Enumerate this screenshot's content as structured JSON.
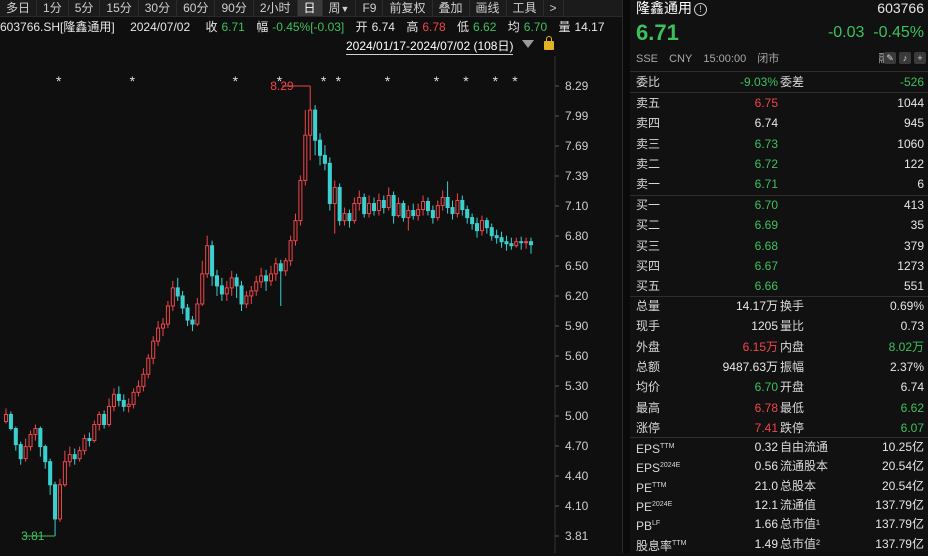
{
  "toolbar": {
    "items": [
      "多日",
      "1分",
      "5分",
      "15分",
      "30分",
      "60分",
      "90分",
      "2小时",
      "日",
      "周",
      "F9",
      "前复权",
      "叠加",
      "画线",
      "工具",
      ">"
    ],
    "active_index": 8
  },
  "infobar": {
    "symbol": "603766.SH[隆鑫通用]",
    "date": "2024/07/02",
    "close_label": "收",
    "close": "6.71",
    "change_label": "幅",
    "change": "-0.45%[-0.03]",
    "open_label": "开",
    "open": "6.74",
    "high_label": "高",
    "high": "6.78",
    "low_label": "低",
    "low": "6.62",
    "avg_label": "均",
    "avg": "6.70",
    "vol_label": "量",
    "vol": "14.17"
  },
  "range_label": "2024/01/17-2024/07/02 (108日)",
  "chart_data": {
    "type": "candlestick",
    "y_ticks": [
      "8.29",
      "7.99",
      "7.69",
      "7.39",
      "7.10",
      "6.80",
      "6.50",
      "6.20",
      "5.90",
      "5.60",
      "5.30",
      "5.00",
      "4.70",
      "4.40",
      "4.10",
      "3.81"
    ],
    "ylim": [
      3.81,
      8.29
    ],
    "high_marker": "8.29",
    "low_marker": "3.81",
    "colors": {
      "up": "#f0454a",
      "down": "#3ad0d0",
      "marker_up": "#f0454a",
      "marker_low": "#3cc05d"
    },
    "candles": [
      [
        4.95,
        5.02,
        4.93,
        5.08
      ],
      [
        5.02,
        4.88,
        4.86,
        5.05
      ],
      [
        4.88,
        4.72,
        4.66,
        4.9
      ],
      [
        4.72,
        4.58,
        4.52,
        4.75
      ],
      [
        4.58,
        4.7,
        4.55,
        4.78
      ],
      [
        4.7,
        4.82,
        4.66,
        4.86
      ],
      [
        4.82,
        4.88,
        4.76,
        4.92
      ],
      [
        4.88,
        4.7,
        4.6,
        4.9
      ],
      [
        4.7,
        4.55,
        4.48,
        4.72
      ],
      [
        4.55,
        4.32,
        4.22,
        4.58
      ],
      [
        4.32,
        3.98,
        3.81,
        4.35
      ],
      [
        3.98,
        4.32,
        3.95,
        4.38
      ],
      [
        4.32,
        4.55,
        4.3,
        4.66
      ],
      [
        4.55,
        4.62,
        4.5,
        4.7
      ],
      [
        4.62,
        4.58,
        4.52,
        4.68
      ],
      [
        4.58,
        4.66,
        4.55,
        4.7
      ],
      [
        4.66,
        4.78,
        4.62,
        4.82
      ],
      [
        4.78,
        4.76,
        4.7,
        4.84
      ],
      [
        4.76,
        4.92,
        4.74,
        4.96
      ],
      [
        4.92,
        5.02,
        4.86,
        5.05
      ],
      [
        5.02,
        4.92,
        4.88,
        5.06
      ],
      [
        4.92,
        5.1,
        4.9,
        5.18
      ],
      [
        5.1,
        5.22,
        5.05,
        5.28
      ],
      [
        5.22,
        5.16,
        5.1,
        5.3
      ],
      [
        5.16,
        5.1,
        5.05,
        5.22
      ],
      [
        5.1,
        5.12,
        5.04,
        5.18
      ],
      [
        5.12,
        5.24,
        5.08,
        5.28
      ],
      [
        5.24,
        5.3,
        5.2,
        5.36
      ],
      [
        5.3,
        5.42,
        5.25,
        5.48
      ],
      [
        5.42,
        5.58,
        5.38,
        5.62
      ],
      [
        5.58,
        5.75,
        5.52,
        5.8
      ],
      [
        5.75,
        5.88,
        5.7,
        5.95
      ],
      [
        5.88,
        5.92,
        5.8,
        5.98
      ],
      [
        5.92,
        6.1,
        5.88,
        6.15
      ],
      [
        6.1,
        6.28,
        6.05,
        6.35
      ],
      [
        6.28,
        6.2,
        6.15,
        6.38
      ],
      [
        6.2,
        6.08,
        6.02,
        6.25
      ],
      [
        6.08,
        5.96,
        5.9,
        6.12
      ],
      [
        5.96,
        5.92,
        5.85,
        6.0
      ],
      [
        5.92,
        6.12,
        5.9,
        6.18
      ],
      [
        6.12,
        6.42,
        6.1,
        6.55
      ],
      [
        6.42,
        6.7,
        6.38,
        6.8
      ],
      [
        6.7,
        6.4,
        6.3,
        6.75
      ],
      [
        6.4,
        6.3,
        6.2,
        6.46
      ],
      [
        6.3,
        6.22,
        6.15,
        6.38
      ],
      [
        6.22,
        6.28,
        6.15,
        6.35
      ],
      [
        6.28,
        6.38,
        6.2,
        6.45
      ],
      [
        6.38,
        6.3,
        6.18,
        6.42
      ],
      [
        6.3,
        6.12,
        6.05,
        6.35
      ],
      [
        6.12,
        6.2,
        6.08,
        6.25
      ],
      [
        6.2,
        6.25,
        6.12,
        6.3
      ],
      [
        6.25,
        6.34,
        6.2,
        6.4
      ],
      [
        6.34,
        6.4,
        6.28,
        6.48
      ],
      [
        6.4,
        6.35,
        6.25,
        6.46
      ],
      [
        6.35,
        6.42,
        6.3,
        6.5
      ],
      [
        6.42,
        6.52,
        6.35,
        6.58
      ],
      [
        6.52,
        6.45,
        6.1,
        6.56
      ],
      [
        6.45,
        6.55,
        6.4,
        6.58
      ],
      [
        6.55,
        6.75,
        6.5,
        6.8
      ],
      [
        6.75,
        6.95,
        6.7,
        7.02
      ],
      [
        6.95,
        7.35,
        6.9,
        7.4
      ],
      [
        7.35,
        7.8,
        7.3,
        8.05
      ],
      [
        7.8,
        8.05,
        7.55,
        8.29
      ],
      [
        8.05,
        7.75,
        7.6,
        8.1
      ],
      [
        7.75,
        7.6,
        7.5,
        7.82
      ],
      [
        7.6,
        7.52,
        7.45,
        7.7
      ],
      [
        7.52,
        7.12,
        7.05,
        7.58
      ],
      [
        7.12,
        7.28,
        6.82,
        7.35
      ],
      [
        7.28,
        6.95,
        6.9,
        7.32
      ],
      [
        6.95,
        7.02,
        6.9,
        7.08
      ],
      [
        7.02,
        6.95,
        6.88,
        7.06
      ],
      [
        6.95,
        7.12,
        6.92,
        7.18
      ],
      [
        7.12,
        7.18,
        7.05,
        7.25
      ],
      [
        7.18,
        7.02,
        6.98,
        7.22
      ],
      [
        7.02,
        7.12,
        6.98,
        7.2
      ],
      [
        7.12,
        7.05,
        7.0,
        7.18
      ],
      [
        7.05,
        7.15,
        7.0,
        7.22
      ],
      [
        7.15,
        7.08,
        7.02,
        7.2
      ],
      [
        7.08,
        7.2,
        7.05,
        7.28
      ],
      [
        7.2,
        7.0,
        6.92,
        7.24
      ],
      [
        7.0,
        7.12,
        6.98,
        7.18
      ],
      [
        7.12,
        6.98,
        6.94,
        7.15
      ],
      [
        6.98,
        7.05,
        6.85,
        7.1
      ],
      [
        7.05,
        7.0,
        6.96,
        7.12
      ],
      [
        7.0,
        7.06,
        6.95,
        7.12
      ],
      [
        7.06,
        7.14,
        7.0,
        7.2
      ],
      [
        7.14,
        7.05,
        7.0,
        7.18
      ],
      [
        7.05,
        6.98,
        6.92,
        7.1
      ],
      [
        6.98,
        7.1,
        6.95,
        7.15
      ],
      [
        7.1,
        7.18,
        7.05,
        7.25
      ],
      [
        7.18,
        7.08,
        7.02,
        7.34
      ],
      [
        7.08,
        7.02,
        6.96,
        7.15
      ],
      [
        7.02,
        7.15,
        6.98,
        7.22
      ],
      [
        7.15,
        7.06,
        7.0,
        7.2
      ],
      [
        7.06,
        6.98,
        6.92,
        7.1
      ],
      [
        6.98,
        6.92,
        6.86,
        7.02
      ],
      [
        6.92,
        6.85,
        6.78,
        6.98
      ],
      [
        6.85,
        6.95,
        6.8,
        7.0
      ],
      [
        6.95,
        6.88,
        6.82,
        6.98
      ],
      [
        6.88,
        6.8,
        6.75,
        6.92
      ],
      [
        6.8,
        6.78,
        6.72,
        6.86
      ],
      [
        6.78,
        6.74,
        6.68,
        6.84
      ],
      [
        6.74,
        6.72,
        6.65,
        6.8
      ],
      [
        6.72,
        6.7,
        6.66,
        6.78
      ],
      [
        6.7,
        6.74,
        6.68,
        6.78
      ],
      [
        6.74,
        6.73,
        6.66,
        6.79
      ],
      [
        6.73,
        6.74,
        6.67,
        6.78
      ],
      [
        6.74,
        6.71,
        6.62,
        6.78
      ]
    ],
    "star_markers_count": 11
  },
  "quote": {
    "title": "隆鑫通用",
    "code": "603766",
    "price": "6.71",
    "change": "-0.03",
    "change_pct": "-0.45%",
    "market": "SSE",
    "currency": "CNY",
    "time": "15:00:00",
    "status": "闭市",
    "rong": "融",
    "tong": "通",
    "weibi_label": "委比",
    "weibi": "-9.03%",
    "weicha_label": "委差",
    "weicha": "-526",
    "asks": [
      {
        "label": "卖五",
        "price": "6.75",
        "vol": "1044",
        "color": "r"
      },
      {
        "label": "卖四",
        "price": "6.74",
        "vol": "945",
        "color": "w"
      },
      {
        "label": "卖三",
        "price": "6.73",
        "vol": "1060",
        "color": "g"
      },
      {
        "label": "卖二",
        "price": "6.72",
        "vol": "122",
        "color": "g"
      },
      {
        "label": "卖一",
        "price": "6.71",
        "vol": "6",
        "color": "g"
      }
    ],
    "bids": [
      {
        "label": "买一",
        "price": "6.70",
        "vol": "413",
        "color": "g"
      },
      {
        "label": "买二",
        "price": "6.69",
        "vol": "35",
        "color": "g"
      },
      {
        "label": "买三",
        "price": "6.68",
        "vol": "379",
        "color": "g"
      },
      {
        "label": "买四",
        "price": "6.67",
        "vol": "1273",
        "color": "g"
      },
      {
        "label": "买五",
        "price": "6.66",
        "vol": "551",
        "color": "g"
      }
    ],
    "stats": [
      {
        "l1": "总量",
        "v1": "14.17万",
        "c1": "w",
        "l2": "换手",
        "v2": "0.69%",
        "c2": "w"
      },
      {
        "l1": "现手",
        "v1": "1205",
        "c1": "w",
        "l2": "量比",
        "v2": "0.73",
        "c2": "w"
      },
      {
        "l1": "外盘",
        "v1": "6.15万",
        "c1": "r",
        "l2": "内盘",
        "v2": "8.02万",
        "c2": "g"
      },
      {
        "l1": "总额",
        "v1": "9487.63万",
        "c1": "w",
        "l2": "振幅",
        "v2": "2.37%",
        "c2": "w"
      },
      {
        "l1": "均价",
        "v1": "6.70",
        "c1": "g",
        "l2": "开盘",
        "v2": "6.74",
        "c2": "w"
      },
      {
        "l1": "最高",
        "v1": "6.78",
        "c1": "r",
        "l2": "最低",
        "v2": "6.62",
        "c2": "g"
      },
      {
        "l1": "涨停",
        "v1": "7.41",
        "c1": "r",
        "l2": "跌停",
        "v2": "6.07",
        "c2": "g"
      }
    ],
    "fundamentals": [
      {
        "l1": "EPS",
        "s1": "TTM",
        "v1": "0.32",
        "l2": "自由流通",
        "v2": "10.25亿"
      },
      {
        "l1": "EPS",
        "s1": "2024E",
        "v1": "0.56",
        "l2": "流通股本",
        "v2": "20.54亿"
      },
      {
        "l1": "PE",
        "s1": "TTM",
        "v1": "21.0",
        "l2": "总股本",
        "v2": "20.54亿"
      },
      {
        "l1": "PE",
        "s1": "2024E",
        "v1": "12.1",
        "l2": "流通值",
        "v2": "137.79亿"
      },
      {
        "l1": "PB",
        "s1": "LF",
        "v1": "1.66",
        "l2": "总市值¹",
        "v2": "137.79亿"
      },
      {
        "l1": "股息率",
        "s1": "TTM",
        "v1": "1.49",
        "l2": "总市值²",
        "v2": "137.79亿"
      }
    ]
  }
}
